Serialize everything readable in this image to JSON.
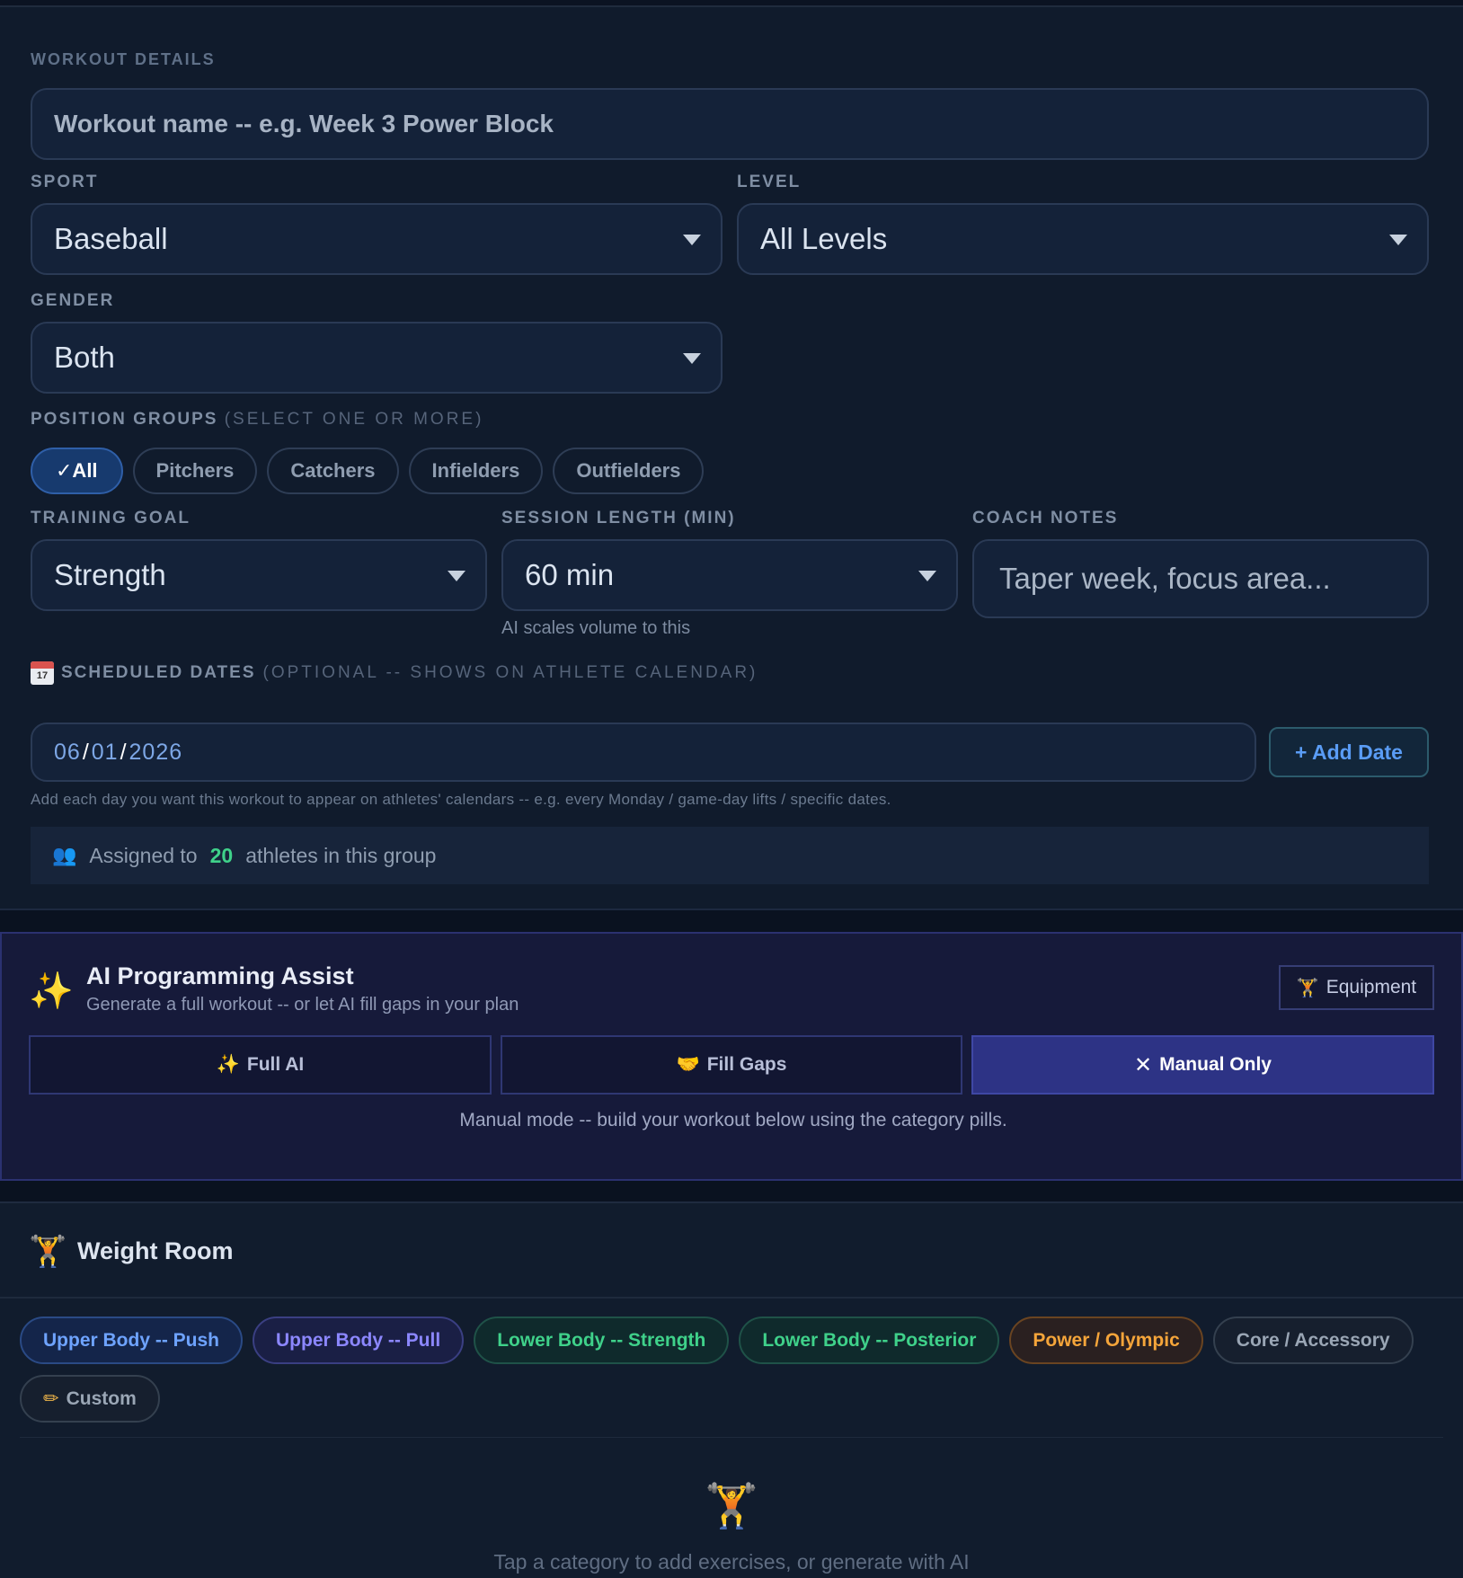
{
  "details": {
    "heading": "WORKOUT DETAILS",
    "workout_name_placeholder": "Workout name -- e.g. Week 3 Power Block",
    "sport_label": "SPORT",
    "sport_value": "Baseball",
    "level_label": "LEVEL",
    "level_value": "All Levels",
    "gender_label": "GENDER",
    "gender_value": "Both",
    "position_label": "POSITION GROUPS",
    "position_hint": "(SELECT ONE OR MORE)",
    "positions": [
      "✓All",
      "Pitchers",
      "Catchers",
      "Infielders",
      "Outfielders"
    ],
    "training_goal_label": "TRAINING GOAL",
    "training_goal_value": "Strength",
    "session_label": "SESSION LENGTH (MIN)",
    "session_value": "60 min",
    "session_helper": "AI scales volume to this",
    "coach_notes_label": "COACH NOTES",
    "coach_notes_placeholder": "Taper week, focus area...",
    "scheduled_label": "SCHEDULED DATES",
    "scheduled_hint": "(OPTIONAL -- SHOWS ON ATHLETE CALENDAR)",
    "date_month": "06",
    "date_day": "01",
    "date_year": "2026",
    "add_date": "+ Add Date",
    "dates_help": "Add each day you want this workout to appear on athletes' calendars -- e.g. every Monday / game-day lifts / specific dates.",
    "assigned_prefix": "Assigned to",
    "assigned_count": "20",
    "assigned_suffix": "athletes in this group"
  },
  "ai": {
    "title": "AI Programming Assist",
    "subtitle": "Generate a full workout -- or let AI fill gaps in your plan",
    "equipment": "Equipment",
    "modes": [
      "Full AI",
      "Fill Gaps",
      "Manual Only"
    ],
    "active_mode": "Manual Only",
    "info": "Manual mode -- build your workout below using the category pills."
  },
  "weight_room": {
    "title": "Weight Room",
    "categories": [
      "Upper Body -- Push",
      "Upper Body -- Pull",
      "Lower Body -- Strength",
      "Lower Body -- Posterior",
      "Power / Olympic",
      "Core / Accessory",
      "Custom"
    ],
    "empty_text": "Tap a category to add exercises, or generate with AI"
  },
  "colors": {
    "accent_green": "#3fd18a",
    "accent_blue": "#5a9cf5",
    "ai_active": "#2d3385"
  },
  "icons": [
    "calendar-icon",
    "people-icon",
    "sparkles-icon",
    "weightlifter-icon",
    "handshake-icon",
    "close-icon",
    "pencil-icon",
    "caret-down-icon"
  ]
}
